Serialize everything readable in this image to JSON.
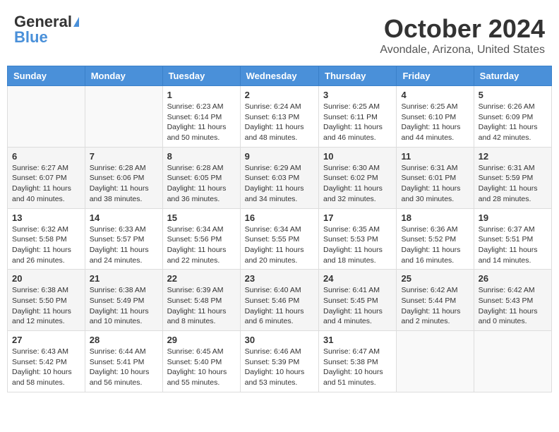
{
  "header": {
    "logo_general": "General",
    "logo_blue": "Blue",
    "month_title": "October 2024",
    "location": "Avondale, Arizona, United States"
  },
  "weekdays": [
    "Sunday",
    "Monday",
    "Tuesday",
    "Wednesday",
    "Thursday",
    "Friday",
    "Saturday"
  ],
  "weeks": [
    [
      {
        "day": "",
        "info": ""
      },
      {
        "day": "",
        "info": ""
      },
      {
        "day": "1",
        "info": "Sunrise: 6:23 AM\nSunset: 6:14 PM\nDaylight: 11 hours and 50 minutes."
      },
      {
        "day": "2",
        "info": "Sunrise: 6:24 AM\nSunset: 6:13 PM\nDaylight: 11 hours and 48 minutes."
      },
      {
        "day": "3",
        "info": "Sunrise: 6:25 AM\nSunset: 6:11 PM\nDaylight: 11 hours and 46 minutes."
      },
      {
        "day": "4",
        "info": "Sunrise: 6:25 AM\nSunset: 6:10 PM\nDaylight: 11 hours and 44 minutes."
      },
      {
        "day": "5",
        "info": "Sunrise: 6:26 AM\nSunset: 6:09 PM\nDaylight: 11 hours and 42 minutes."
      }
    ],
    [
      {
        "day": "6",
        "info": "Sunrise: 6:27 AM\nSunset: 6:07 PM\nDaylight: 11 hours and 40 minutes."
      },
      {
        "day": "7",
        "info": "Sunrise: 6:28 AM\nSunset: 6:06 PM\nDaylight: 11 hours and 38 minutes."
      },
      {
        "day": "8",
        "info": "Sunrise: 6:28 AM\nSunset: 6:05 PM\nDaylight: 11 hours and 36 minutes."
      },
      {
        "day": "9",
        "info": "Sunrise: 6:29 AM\nSunset: 6:03 PM\nDaylight: 11 hours and 34 minutes."
      },
      {
        "day": "10",
        "info": "Sunrise: 6:30 AM\nSunset: 6:02 PM\nDaylight: 11 hours and 32 minutes."
      },
      {
        "day": "11",
        "info": "Sunrise: 6:31 AM\nSunset: 6:01 PM\nDaylight: 11 hours and 30 minutes."
      },
      {
        "day": "12",
        "info": "Sunrise: 6:31 AM\nSunset: 5:59 PM\nDaylight: 11 hours and 28 minutes."
      }
    ],
    [
      {
        "day": "13",
        "info": "Sunrise: 6:32 AM\nSunset: 5:58 PM\nDaylight: 11 hours and 26 minutes."
      },
      {
        "day": "14",
        "info": "Sunrise: 6:33 AM\nSunset: 5:57 PM\nDaylight: 11 hours and 24 minutes."
      },
      {
        "day": "15",
        "info": "Sunrise: 6:34 AM\nSunset: 5:56 PM\nDaylight: 11 hours and 22 minutes."
      },
      {
        "day": "16",
        "info": "Sunrise: 6:34 AM\nSunset: 5:55 PM\nDaylight: 11 hours and 20 minutes."
      },
      {
        "day": "17",
        "info": "Sunrise: 6:35 AM\nSunset: 5:53 PM\nDaylight: 11 hours and 18 minutes."
      },
      {
        "day": "18",
        "info": "Sunrise: 6:36 AM\nSunset: 5:52 PM\nDaylight: 11 hours and 16 minutes."
      },
      {
        "day": "19",
        "info": "Sunrise: 6:37 AM\nSunset: 5:51 PM\nDaylight: 11 hours and 14 minutes."
      }
    ],
    [
      {
        "day": "20",
        "info": "Sunrise: 6:38 AM\nSunset: 5:50 PM\nDaylight: 11 hours and 12 minutes."
      },
      {
        "day": "21",
        "info": "Sunrise: 6:38 AM\nSunset: 5:49 PM\nDaylight: 11 hours and 10 minutes."
      },
      {
        "day": "22",
        "info": "Sunrise: 6:39 AM\nSunset: 5:48 PM\nDaylight: 11 hours and 8 minutes."
      },
      {
        "day": "23",
        "info": "Sunrise: 6:40 AM\nSunset: 5:46 PM\nDaylight: 11 hours and 6 minutes."
      },
      {
        "day": "24",
        "info": "Sunrise: 6:41 AM\nSunset: 5:45 PM\nDaylight: 11 hours and 4 minutes."
      },
      {
        "day": "25",
        "info": "Sunrise: 6:42 AM\nSunset: 5:44 PM\nDaylight: 11 hours and 2 minutes."
      },
      {
        "day": "26",
        "info": "Sunrise: 6:42 AM\nSunset: 5:43 PM\nDaylight: 11 hours and 0 minutes."
      }
    ],
    [
      {
        "day": "27",
        "info": "Sunrise: 6:43 AM\nSunset: 5:42 PM\nDaylight: 10 hours and 58 minutes."
      },
      {
        "day": "28",
        "info": "Sunrise: 6:44 AM\nSunset: 5:41 PM\nDaylight: 10 hours and 56 minutes."
      },
      {
        "day": "29",
        "info": "Sunrise: 6:45 AM\nSunset: 5:40 PM\nDaylight: 10 hours and 55 minutes."
      },
      {
        "day": "30",
        "info": "Sunrise: 6:46 AM\nSunset: 5:39 PM\nDaylight: 10 hours and 53 minutes."
      },
      {
        "day": "31",
        "info": "Sunrise: 6:47 AM\nSunset: 5:38 PM\nDaylight: 10 hours and 51 minutes."
      },
      {
        "day": "",
        "info": ""
      },
      {
        "day": "",
        "info": ""
      }
    ]
  ]
}
